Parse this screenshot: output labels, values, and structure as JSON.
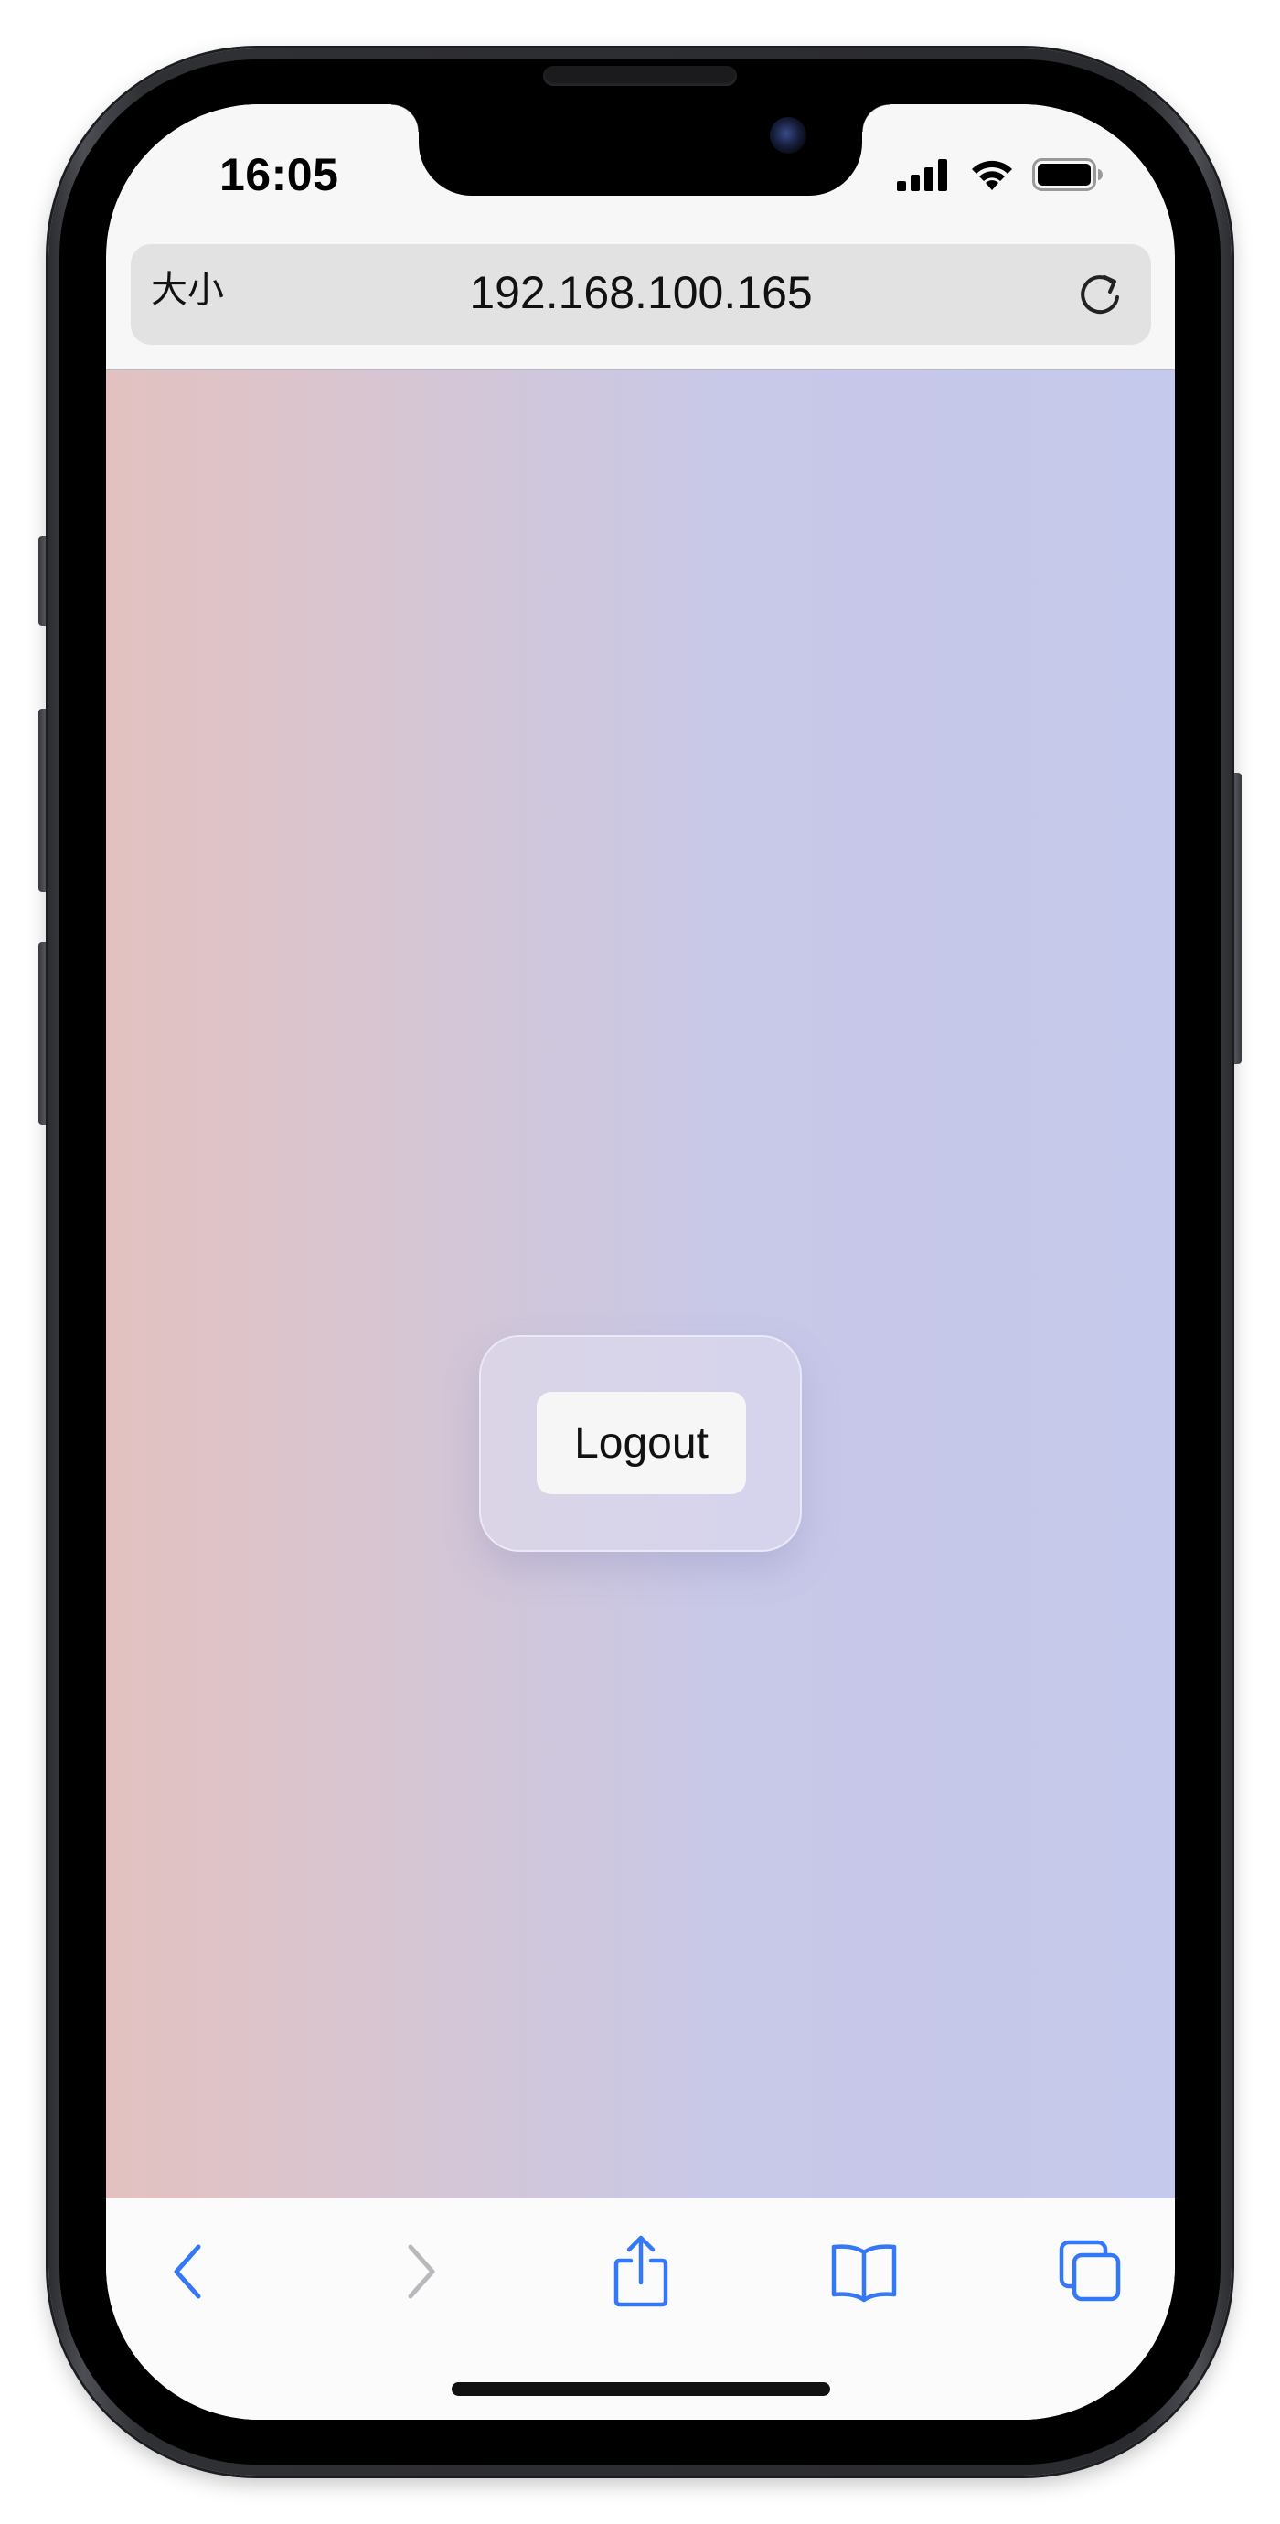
{
  "status_bar": {
    "time": "16:05"
  },
  "browser": {
    "text_size_label": "大小",
    "url": "192.168.100.165"
  },
  "page": {
    "logout_label": "Logout"
  },
  "toolbar": {
    "icons": [
      "back-icon",
      "forward-icon",
      "share-icon",
      "bookmarks-icon",
      "tabs-icon"
    ]
  },
  "colors": {
    "accent": "#3478f6",
    "disabled": "#b9b9bd",
    "gradient_start": "#e3c1c0",
    "gradient_end": "#c5c9eb"
  }
}
